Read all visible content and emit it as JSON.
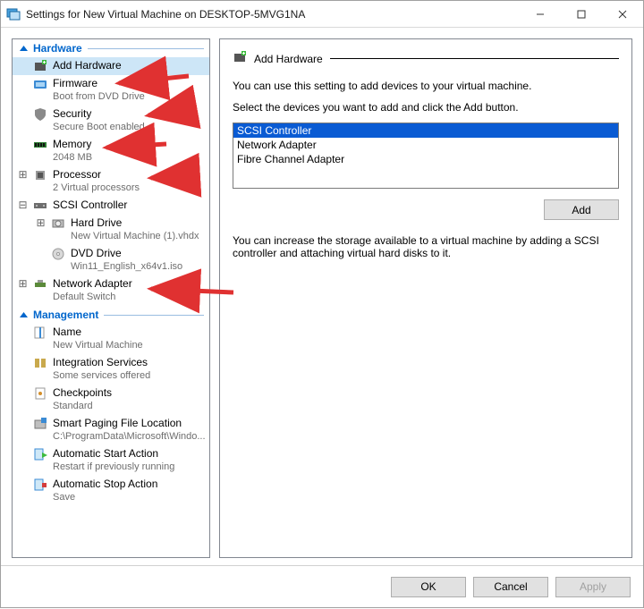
{
  "window_title": "Settings for New Virtual Machine on DESKTOP-5MVG1NA",
  "nav": {
    "hardware_label": "Hardware",
    "management_label": "Management",
    "add_hardware": "Add Hardware",
    "firmware": {
      "label": "Firmware",
      "sub": "Boot from DVD Drive"
    },
    "security": {
      "label": "Security",
      "sub": "Secure Boot enabled"
    },
    "memory": {
      "label": "Memory",
      "sub": "2048 MB"
    },
    "processor": {
      "label": "Processor",
      "sub": "2 Virtual processors"
    },
    "scsi": {
      "label": "SCSI Controller"
    },
    "hard_drive": {
      "label": "Hard Drive",
      "sub": "New Virtual Machine (1).vhdx"
    },
    "dvd_drive": {
      "label": "DVD Drive",
      "sub": "Win11_English_x64v1.iso"
    },
    "net_adapter": {
      "label": "Network Adapter",
      "sub": "Default Switch"
    },
    "name": {
      "label": "Name",
      "sub": "New Virtual Machine"
    },
    "integration": {
      "label": "Integration Services",
      "sub": "Some services offered"
    },
    "checkpoints": {
      "label": "Checkpoints",
      "sub": "Standard"
    },
    "smart_paging": {
      "label": "Smart Paging File Location",
      "sub": "C:\\ProgramData\\Microsoft\\Windo..."
    },
    "auto_start": {
      "label": "Automatic Start Action",
      "sub": "Restart if previously running"
    },
    "auto_stop": {
      "label": "Automatic Stop Action",
      "sub": "Save"
    }
  },
  "panel": {
    "title": "Add Hardware",
    "intro1": "You can use this setting to add devices to your virtual machine.",
    "intro2": "Select the devices you want to add and click the Add button.",
    "devices": [
      "SCSI Controller",
      "Network Adapter",
      "Fibre Channel Adapter"
    ],
    "selected_index": 0,
    "add_label": "Add",
    "note": "You can increase the storage available to a virtual machine by adding a SCSI controller and attaching virtual hard disks to it."
  },
  "buttons": {
    "ok": "OK",
    "cancel": "Cancel",
    "apply": "Apply"
  }
}
